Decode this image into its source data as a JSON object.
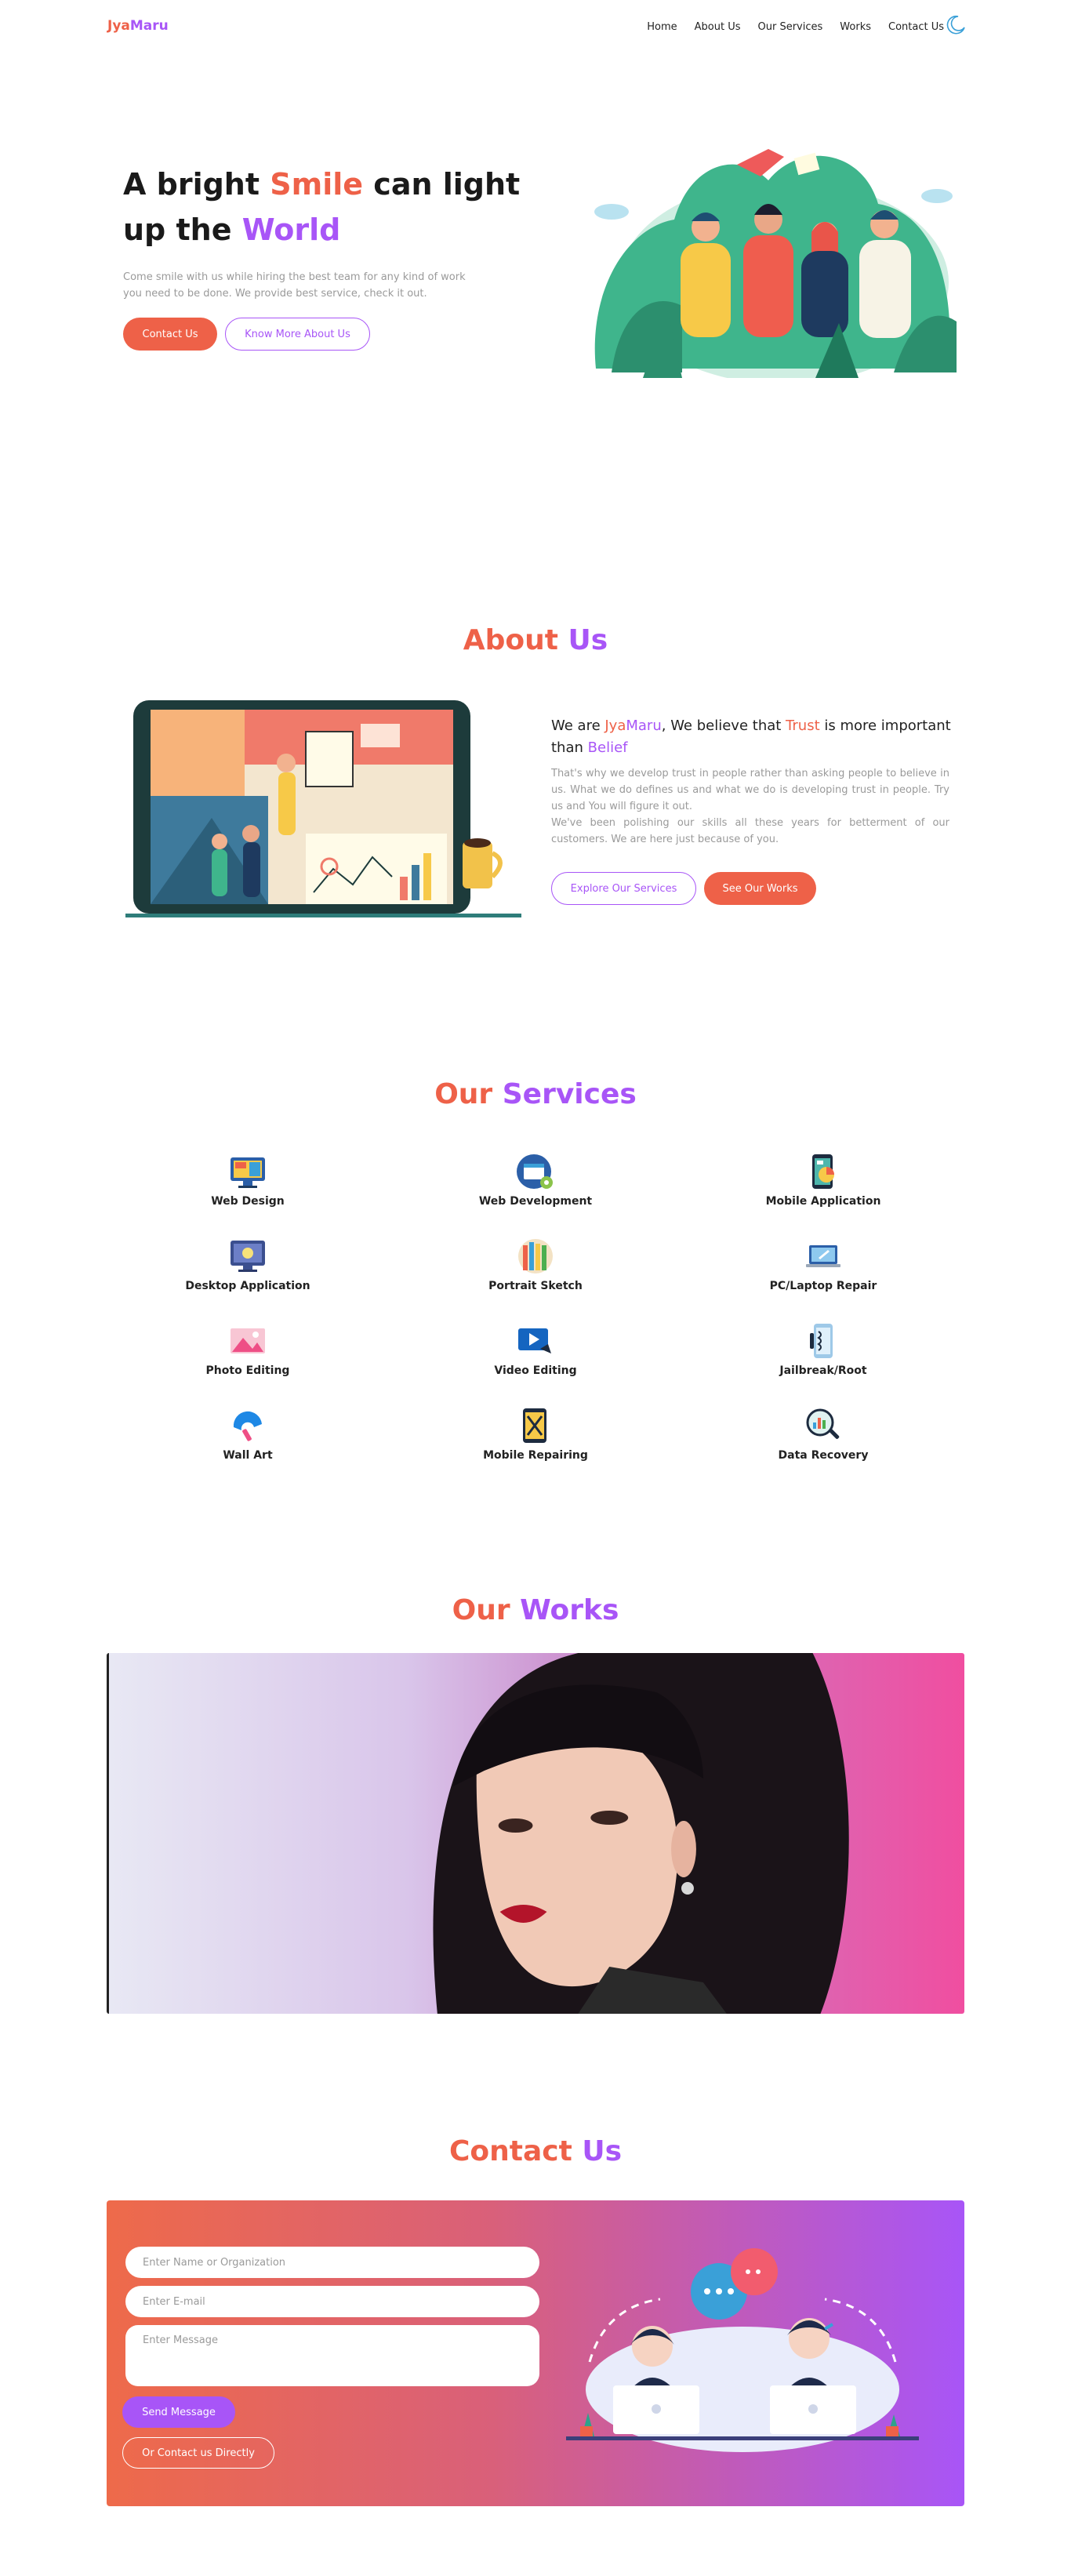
{
  "brand": {
    "part1": "Jya",
    "part2": "Maru"
  },
  "nav": {
    "items": [
      "Home",
      "About Us",
      "Our Services",
      "Works",
      "Contact Us"
    ]
  },
  "icons": {
    "theme_toggle": "moon-icon"
  },
  "colors": {
    "accent_orange": "#ee6148",
    "accent_purple": "#a855f7"
  },
  "hero": {
    "title_part1": "A bright ",
    "title_highlight1": "Smile",
    "title_part2": " can light",
    "title_part3": "up the ",
    "title_highlight2": "World",
    "subtitle": "Come smile with us while hiring the best team for any kind of work you need to be done. We provide best service, check it out.",
    "primary_button": "Contact Us",
    "secondary_button": "Know More About Us"
  },
  "about": {
    "title_part1": "About ",
    "title_part2": "Us",
    "head_1": "We are ",
    "head_brand1": "Jya",
    "head_brand2": "Maru",
    "head_2": ", We believe that ",
    "head_trust": "Trust",
    "head_3": " is more important than ",
    "head_belief": "Belief",
    "para_1": "That's why we develop trust in people rather than asking people to believe in us. What we do defines us and what we do is developing trust in people. Try us and You will figure it out.",
    "para_2": "We've been polishing our skills all these years for betterment of our customers. We are here just because of you.",
    "button_services": "Explore Our Services",
    "button_works": "See Our Works"
  },
  "services": {
    "title_part1": "Our ",
    "title_part2": "Services",
    "items": [
      {
        "label": "Web Design",
        "icon": "web-design-icon"
      },
      {
        "label": "Web Development",
        "icon": "web-development-icon"
      },
      {
        "label": "Mobile Application",
        "icon": "mobile-application-icon"
      },
      {
        "label": "Desktop Application",
        "icon": "desktop-application-icon"
      },
      {
        "label": "Portrait Sketch",
        "icon": "portrait-sketch-icon"
      },
      {
        "label": "PC/Laptop Repair",
        "icon": "laptop-repair-icon"
      },
      {
        "label": "Photo Editing",
        "icon": "photo-editing-icon"
      },
      {
        "label": "Video Editing",
        "icon": "video-editing-icon"
      },
      {
        "label": "Jailbreak/Root",
        "icon": "jailbreak-icon"
      },
      {
        "label": "Wall Art",
        "icon": "wall-art-icon"
      },
      {
        "label": "Mobile Repairing",
        "icon": "mobile-repairing-icon"
      },
      {
        "label": "Data Recovery",
        "icon": "data-recovery-icon"
      }
    ]
  },
  "works": {
    "title_part1": "Our ",
    "title_part2": "Works"
  },
  "contact": {
    "title_part1": "Contact ",
    "title_part2": "Us",
    "name_placeholder": "Enter Name or Organization",
    "email_placeholder": "Enter E-mail",
    "message_placeholder": "Enter Message",
    "send_button": "Send Message",
    "direct_button": "Or Contact us Directly"
  }
}
